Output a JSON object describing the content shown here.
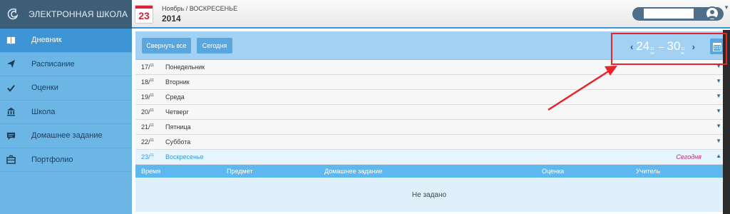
{
  "app": {
    "title": "ЭЛЕКТРОННАЯ ШКОЛА"
  },
  "sidebar": {
    "items": [
      {
        "label": "Дневник",
        "icon": "book-icon",
        "active": true
      },
      {
        "label": "Расписание",
        "icon": "paper-plane-icon",
        "active": false
      },
      {
        "label": "Оценки",
        "icon": "checkmark-icon",
        "active": false
      },
      {
        "label": "Школа",
        "icon": "bank-icon",
        "active": false
      },
      {
        "label": "Домашнее задание",
        "icon": "chat-icon",
        "active": false
      },
      {
        "label": "Портфолио",
        "icon": "briefcase-icon",
        "active": false
      }
    ]
  },
  "header": {
    "day": "23",
    "month_weekday": "Ноябрь / ВОСКРЕСЕНЬЕ",
    "year": "2014"
  },
  "toolbar": {
    "collapse_label": "Свернуть все",
    "today_label": "Сегодня"
  },
  "week": {
    "start_day": "24",
    "start_meta_top": "11",
    "start_meta_bottom": "пн",
    "end_day": "30",
    "end_meta_top": "11",
    "end_meta_bottom": "вс",
    "dash": "–",
    "prev": "‹",
    "next": "›"
  },
  "days": [
    {
      "num": "17",
      "month": "11",
      "name": "Понедельник"
    },
    {
      "num": "18",
      "month": "11",
      "name": "Вторник"
    },
    {
      "num": "19",
      "month": "11",
      "name": "Среда"
    },
    {
      "num": "20",
      "month": "11",
      "name": "Четверг"
    },
    {
      "num": "21",
      "month": "11",
      "name": "Пятница"
    },
    {
      "num": "22",
      "month": "11",
      "name": "Суббота"
    },
    {
      "num": "23",
      "month": "11",
      "name": "Воскресенье",
      "today_label": "Сегодня"
    }
  ],
  "table": {
    "headers": [
      "Время",
      "Предмет",
      "Домашнее задание",
      "Оценка",
      "Учитель"
    ],
    "empty_text": "Не задано"
  },
  "colors": {
    "accent": "#3d95d6",
    "sidebar": "#6cb6e6",
    "annotation": "#e8232b",
    "today_label": "#c0266e"
  }
}
